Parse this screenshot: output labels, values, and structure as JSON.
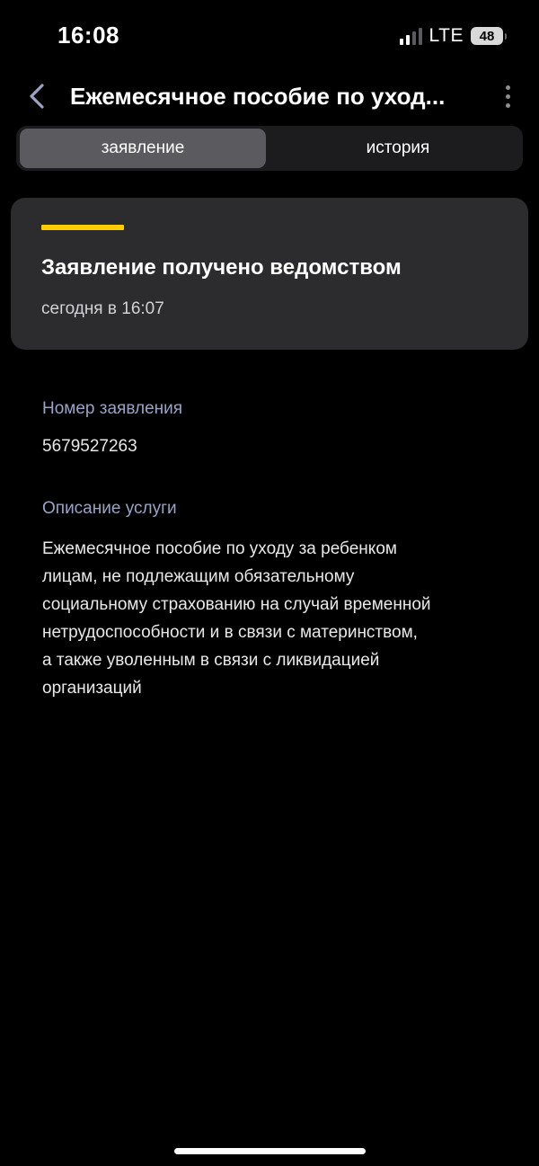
{
  "status_bar": {
    "time": "16:08",
    "network": "LTE",
    "battery": "48"
  },
  "header": {
    "title": "Ежемесячное пособие по уход...",
    "back_icon": "chevron-left-icon",
    "more_icon": "more-vertical-icon"
  },
  "tabs": [
    {
      "label": "заявление",
      "active": true
    },
    {
      "label": "история",
      "active": false
    }
  ],
  "status_card": {
    "title": "Заявление получено ведомством",
    "time": "сегодня в 16:07",
    "accent_color": "#ffcc00"
  },
  "application": {
    "number_label": "Номер заявления",
    "number_value": "5679527263",
    "description_label": "Описание услуги",
    "description_lines": [
      "Ежемесячное пособие по уходу за ребенком",
      "лицам, не подлежащим обязательному",
      "социальному страхованию на случай временной",
      "нетрудоспособности и в связи с материнством,",
      "а также уволенным в связи с ликвидацией",
      "организаций"
    ]
  },
  "colors": {
    "background": "#000000",
    "card": "#2c2c2e",
    "label": "#9aa3c4"
  }
}
